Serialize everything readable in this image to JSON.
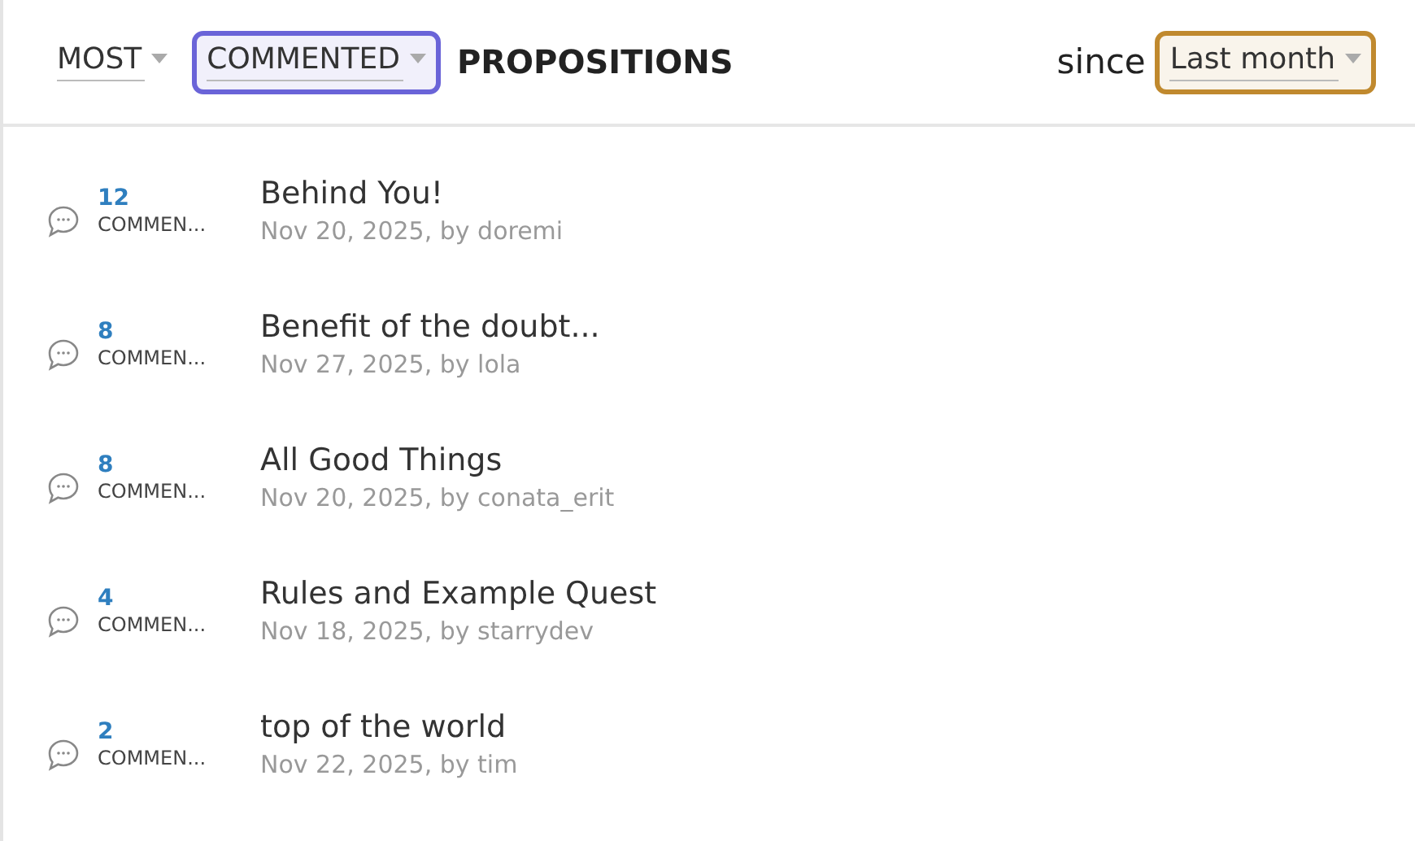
{
  "header": {
    "left": [
      {
        "kind": "dropdown",
        "value": "MOST"
      },
      {
        "kind": "dropdown",
        "value": "COMMENTED",
        "color": "#6a64d8"
      },
      {
        "kind": "label",
        "text": "PROPOSITIONS"
      }
    ],
    "right": [
      {
        "kind": "text",
        "text": "since"
      },
      {
        "kind": "dropdown",
        "value": "Last month",
        "color": "#c0892e"
      }
    ]
  },
  "propositions": [
    {
      "count": "12",
      "count_label": "COMMEN...",
      "title": "Behind You!",
      "meta": "Nov 20, 2025, by doremi"
    },
    {
      "count": "8",
      "count_label": "COMMEN...",
      "title": "Benefit of the doubt...",
      "meta": "Nov 27, 2025, by lola"
    },
    {
      "count": "8",
      "count_label": "COMMEN...",
      "title": "All Good Things",
      "meta": "Nov 20, 2025, by conata_erit"
    },
    {
      "count": "4",
      "count_label": "COMMEN...",
      "title": "Rules and Example Quest",
      "meta": "Nov 18, 2025, by starrydev"
    },
    {
      "count": "2",
      "count_label": "COMMEN...",
      "title": "top of the world",
      "meta": "Nov 22, 2025, by tim"
    }
  ]
}
